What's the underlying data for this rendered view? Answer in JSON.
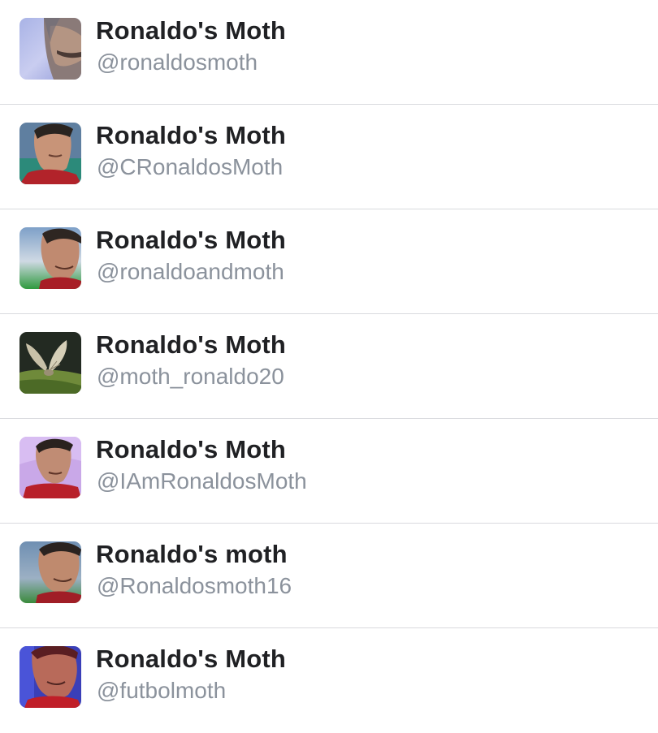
{
  "accounts": [
    {
      "name": "Ronaldo's Moth",
      "handle": "@ronaldosmoth"
    },
    {
      "name": "Ronaldo's Moth",
      "handle": "@CRonaldosMoth"
    },
    {
      "name": "Ronaldo's Moth",
      "handle": "@ronaldoandmoth"
    },
    {
      "name": "Ronaldo's Moth",
      "handle": "@moth_ronaldo20"
    },
    {
      "name": "Ronaldo's Moth",
      "handle": "@IAmRonaldosMoth"
    },
    {
      "name": "Ronaldo's moth",
      "handle": "@Ronaldosmoth16"
    },
    {
      "name": "Ronaldo's Moth",
      "handle": "@futbolmoth"
    }
  ],
  "colors": {
    "name_text": "#202124",
    "handle_text": "#8b929c",
    "divider": "#d9dade"
  }
}
